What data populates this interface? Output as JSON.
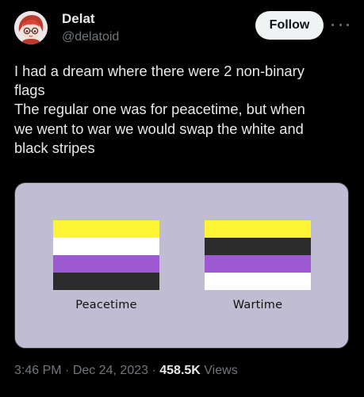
{
  "author": {
    "display_name": "Delat",
    "handle": "@delatoid"
  },
  "follow_label": "Follow",
  "tweet": {
    "lines": [
      "I had a dream where there were 2 non-binary",
      "flags",
      "The regular one was for peacetime, but when",
      "we went to war we would swap the white and",
      "black stripes"
    ]
  },
  "media": {
    "background": "#c0bdd3",
    "flags": [
      {
        "caption": "Peacetime",
        "stripes": [
          "#fcf434",
          "#ffffff",
          "#9c59d1",
          "#2c2c2c"
        ]
      },
      {
        "caption": "Wartime",
        "stripes": [
          "#fcf434",
          "#2c2c2c",
          "#9c59d1",
          "#ffffff"
        ]
      }
    ]
  },
  "meta": {
    "time": "3:46 PM",
    "date": "Dec 24, 2023",
    "views_count": "458.5K",
    "views_label": "Views"
  },
  "icons": {
    "more": "more-horizontal-icon"
  }
}
